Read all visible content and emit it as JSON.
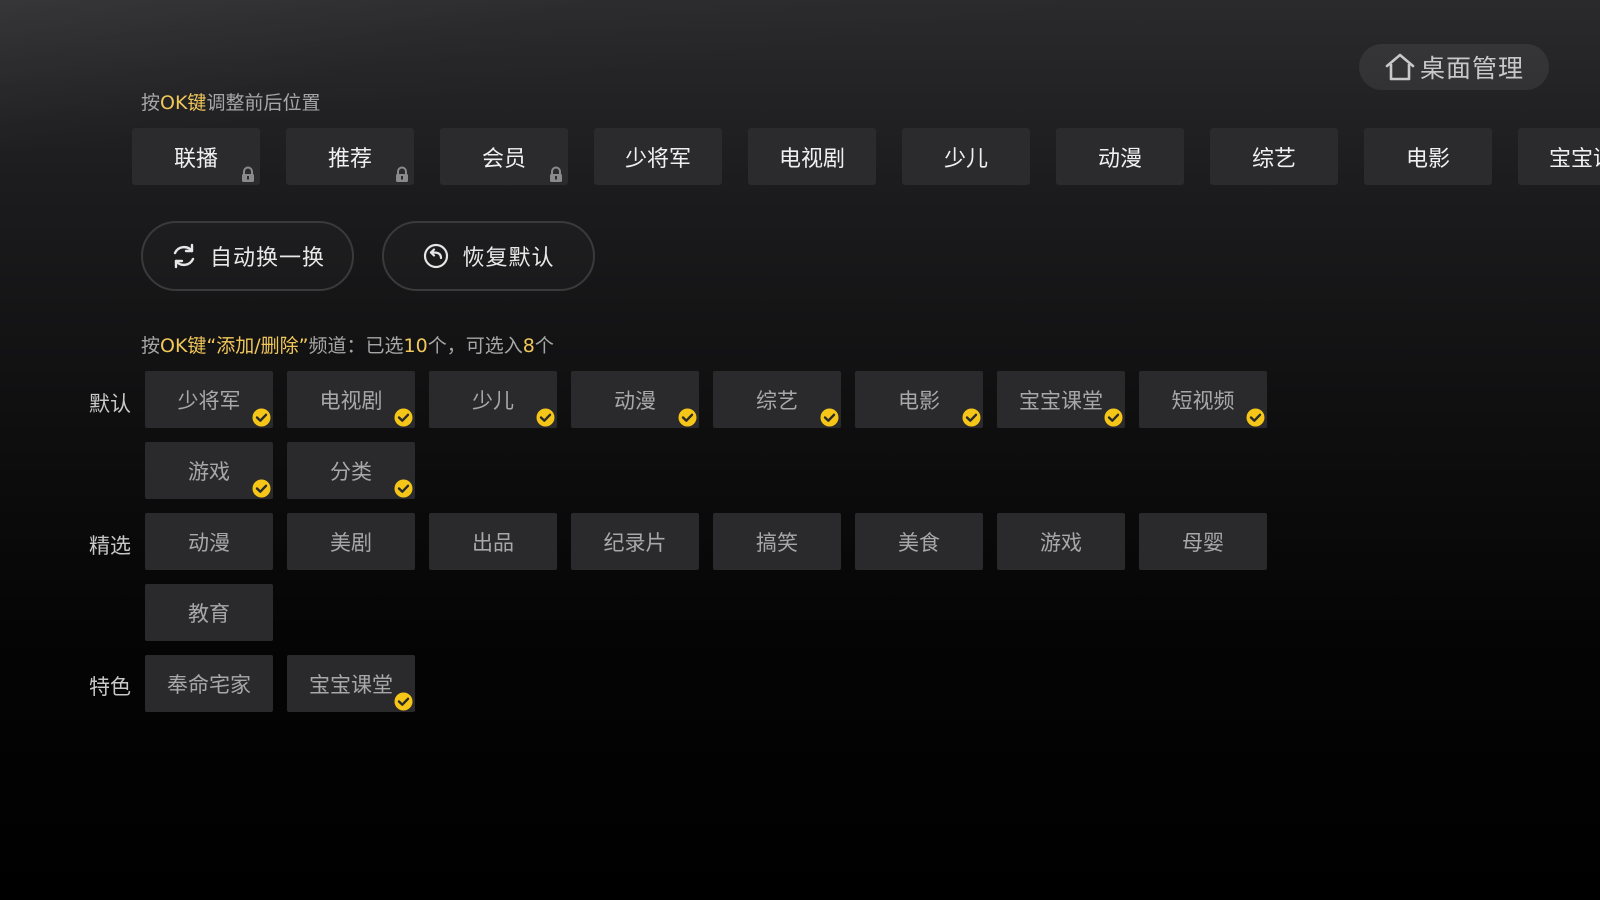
{
  "header": {
    "home_label": "桌面管理",
    "home_icon": "home-icon"
  },
  "hint_top": {
    "prefix": "按",
    "key": "OK键",
    "suffix": "调整前后位置"
  },
  "tabs": [
    {
      "label": "联播",
      "locked": true
    },
    {
      "label": "推荐",
      "locked": true
    },
    {
      "label": "会员",
      "locked": true
    },
    {
      "label": "少将军",
      "locked": false
    },
    {
      "label": "电视剧",
      "locked": false
    },
    {
      "label": "少儿",
      "locked": false
    },
    {
      "label": "动漫",
      "locked": false
    },
    {
      "label": "综艺",
      "locked": false
    },
    {
      "label": "电影",
      "locked": false
    },
    {
      "label": "宝宝课",
      "locked": false
    }
  ],
  "actions": {
    "auto_label": "自动换一换",
    "auto_icon": "refresh-icon",
    "restore_label": "恢复默认",
    "restore_icon": "restore-icon"
  },
  "hint_channels": {
    "prefix": "按",
    "key": "OK键",
    "quoted": "“添加/删除”",
    "mid": "频道：已选",
    "selected": "10",
    "mid2": "个，可选入",
    "available": "8",
    "suffix": "个"
  },
  "sections": {
    "default": {
      "label": "默认",
      "items": [
        {
          "label": "少将军",
          "checked": true
        },
        {
          "label": "电视剧",
          "checked": true
        },
        {
          "label": "少儿",
          "checked": true
        },
        {
          "label": "动漫",
          "checked": true
        },
        {
          "label": "综艺",
          "checked": true
        },
        {
          "label": "电影",
          "checked": true
        },
        {
          "label": "宝宝课堂",
          "checked": true
        },
        {
          "label": "短视频",
          "checked": true
        },
        {
          "label": "游戏",
          "checked": true
        },
        {
          "label": "分类",
          "checked": true
        }
      ]
    },
    "featured": {
      "label": "精选",
      "items": [
        {
          "label": "动漫",
          "checked": false
        },
        {
          "label": "美剧",
          "checked": false
        },
        {
          "label": "出品",
          "checked": false
        },
        {
          "label": "纪录片",
          "checked": false
        },
        {
          "label": "搞笑",
          "checked": false
        },
        {
          "label": "美食",
          "checked": false
        },
        {
          "label": "游戏",
          "checked": false
        },
        {
          "label": "母婴",
          "checked": false
        },
        {
          "label": "教育",
          "checked": false
        }
      ]
    },
    "special": {
      "label": "特色",
      "items": [
        {
          "label": "奉命宅家",
          "checked": false
        },
        {
          "label": "宝宝课堂",
          "checked": true
        }
      ]
    }
  },
  "colors": {
    "accent": "#f1c75a",
    "check": "#f5c518",
    "chip_bg": "#2a2a2d",
    "tab_bg": "#2b2b2e"
  }
}
